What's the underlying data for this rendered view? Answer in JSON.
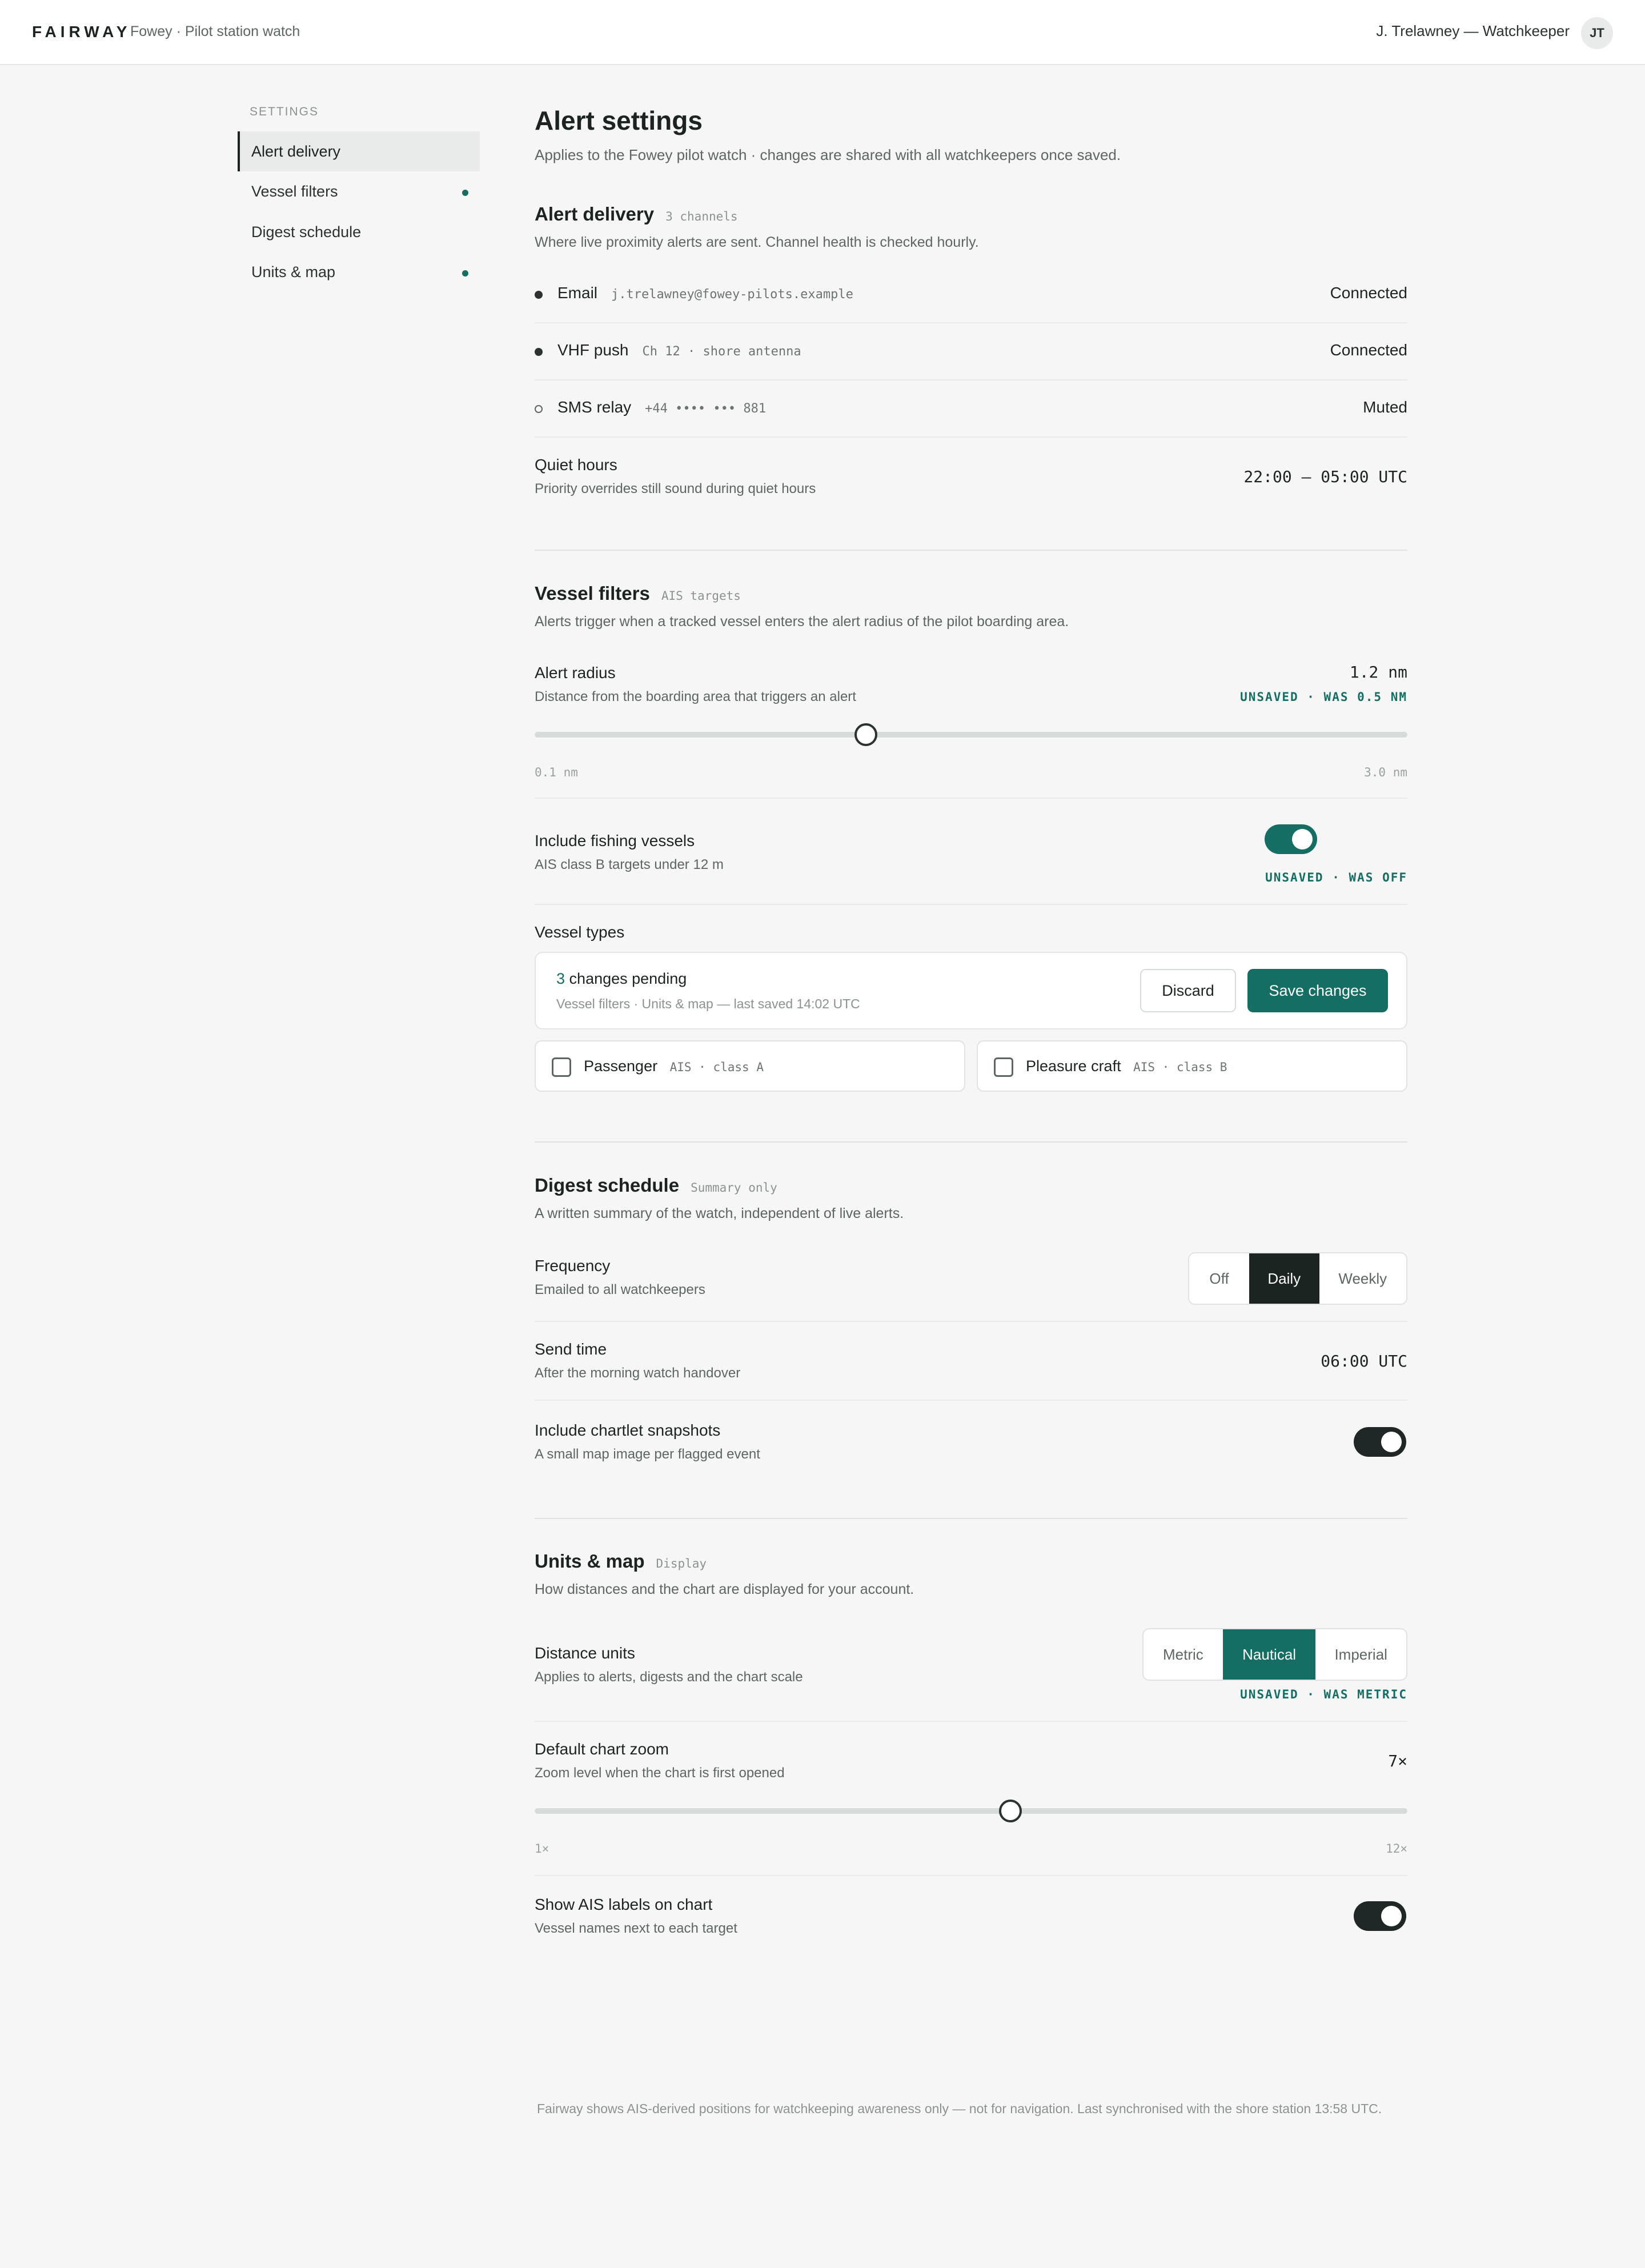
{
  "topbar": {
    "brand": "FAIRWAY",
    "station": "Fowey · Pilot station watch",
    "user": "J. Trelawney — Watchkeeper",
    "avatar_initials": "JT"
  },
  "sidebar": {
    "heading": "SETTINGS",
    "items": [
      {
        "label": "Alert delivery",
        "active": true,
        "dot": false
      },
      {
        "label": "Vessel filters",
        "active": false,
        "dot": true
      },
      {
        "label": "Digest schedule",
        "active": false,
        "dot": false
      },
      {
        "label": "Units & map",
        "active": false,
        "dot": true
      }
    ]
  },
  "page": {
    "title": "Alert settings",
    "subtitle": "Applies to the Fowey pilot watch · changes are shared with all watchkeepers once saved."
  },
  "alert_delivery": {
    "title": "Alert delivery",
    "tag": "3 channels",
    "description": "Where live proximity alerts are sent. Channel health is checked hourly.",
    "channels": [
      {
        "name": "Email",
        "detail": "j.trelawney@fowey-pilots.example",
        "status": "Connected",
        "state": "connected"
      },
      {
        "name": "VHF push",
        "detail": "Ch 12 · shore antenna",
        "status": "Connected",
        "state": "connected"
      },
      {
        "name": "SMS relay",
        "detail": "+44 •••• ••• 881",
        "status": "Muted",
        "state": "muted"
      }
    ],
    "quiet_hours": {
      "title": "Quiet hours",
      "description": "Priority overrides still sound during quiet hours",
      "value": "22:00 – 05:00 UTC"
    }
  },
  "vessel_filters": {
    "title": "Vessel filters",
    "tag": "AIS targets",
    "description": "Alerts trigger when a tracked vessel enters the alert radius of the pilot boarding area.",
    "alert_radius": {
      "title": "Alert radius",
      "description": "Distance from the boarding area that triggers an alert",
      "value": "1.2 nm",
      "unsaved": "UNSAVED · WAS 0.5 NM",
      "min_label": "0.1 nm",
      "max_label": "3.0 nm",
      "min": 0.1,
      "max": 3.0,
      "current": 1.2
    },
    "fishing": {
      "title": "Include fishing vessels",
      "description": "AIS class B targets under 12 m",
      "on": true,
      "unsaved": "UNSAVED · WAS OFF"
    },
    "types": {
      "title": "Vessel types",
      "items": [
        {
          "label": "Passenger",
          "meta": "AIS · class A",
          "checked": false
        },
        {
          "label": "Pleasure craft",
          "meta": "AIS · class B",
          "checked": false
        }
      ]
    }
  },
  "pending_bar": {
    "count": "3",
    "label": "changes pending",
    "detail": "Vessel filters · Units & map — last saved 14:02 UTC",
    "discard": "Discard",
    "save": "Save changes"
  },
  "digest": {
    "title": "Digest schedule",
    "tag": "Summary only",
    "description": "A written summary of the watch, independent of live alerts.",
    "frequency": {
      "title": "Frequency",
      "description": "Emailed to all watchkeepers",
      "options": [
        "Off",
        "Daily",
        "Weekly"
      ],
      "selected": "Daily"
    },
    "send_time": {
      "title": "Send time",
      "description": "After the morning watch handover",
      "value": "06:00 UTC"
    },
    "snapshots": {
      "title": "Include chartlet snapshots",
      "description": "A small map image per flagged event",
      "on": true
    }
  },
  "units": {
    "title": "Units & map",
    "tag": "Display",
    "description": "How distances and the chart are displayed for your account.",
    "distance": {
      "title": "Distance units",
      "description": "Applies to alerts, digests and the chart scale",
      "options": [
        "Metric",
        "Nautical",
        "Imperial"
      ],
      "selected": "Nautical",
      "unsaved": "UNSAVED · WAS METRIC"
    },
    "zoom": {
      "title": "Default chart zoom",
      "description": "Zoom level when the chart is first opened",
      "value": "7×",
      "min_label": "1×",
      "max_label": "12×",
      "min": 1,
      "max": 12,
      "current": 7
    },
    "ais_labels": {
      "title": "Show AIS labels on chart",
      "description": "Vessel names next to each target",
      "on": true
    }
  },
  "footer": {
    "text": "Fairway shows AIS-derived positions for watchkeeping awareness only — not for navigation. Last synchronised with the shore station 13:58 UTC."
  },
  "colors": {
    "accent": "#146e64",
    "ink": "#1c2422",
    "background": "#f5f6f5"
  }
}
